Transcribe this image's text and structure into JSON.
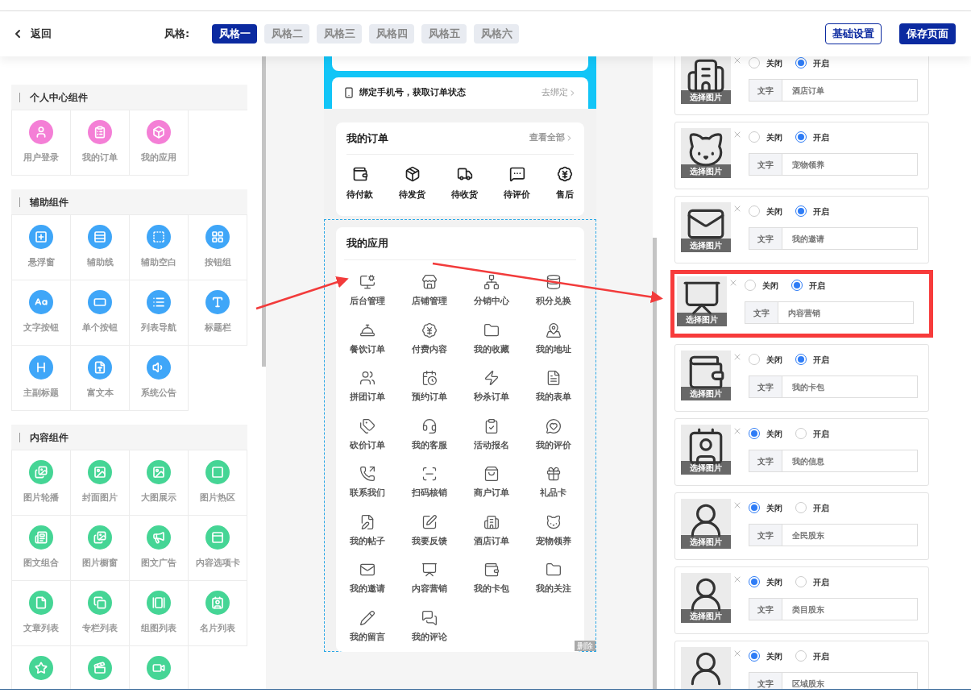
{
  "header": {
    "back": "返回",
    "style_label": "风格:",
    "styles": [
      {
        "label": "风格一",
        "selected": true
      },
      {
        "label": "风格二",
        "selected": false
      },
      {
        "label": "风格三",
        "selected": false
      },
      {
        "label": "风格四",
        "selected": false
      },
      {
        "label": "风格五",
        "selected": false
      },
      {
        "label": "风格六",
        "selected": false
      }
    ],
    "buttons": [
      {
        "label": "基础设置",
        "kind": "outline"
      },
      {
        "label": "保存页面",
        "kind": "primary"
      }
    ]
  },
  "component_groups": [
    {
      "title": "个人中心组件",
      "color": "#f47fd6",
      "items": [
        {
          "kind": "labeled",
          "label": "用户登录"
        },
        {
          "kind": "labeled",
          "label": "我的订单"
        },
        {
          "kind": "labeled",
          "label": "我的应用"
        }
      ]
    },
    {
      "title": "辅助组件",
      "color": "#3fa6f8",
      "items": [
        {
          "kind": "labeled",
          "label": "悬浮窗"
        },
        {
          "kind": "labeled",
          "label": "辅助线"
        },
        {
          "kind": "labeled",
          "label": "辅助空白"
        },
        {
          "kind": "labeled",
          "label": "按钮组"
        },
        {
          "kind": "labeled",
          "label": "文字按钮"
        },
        {
          "kind": "labeled",
          "label": "单个按钮"
        },
        {
          "kind": "labeled",
          "label": "列表导航"
        },
        {
          "kind": "labeled",
          "label": "标题栏"
        },
        {
          "kind": "labeled",
          "label": "主副标题"
        },
        {
          "kind": "labeled",
          "label": "富文本"
        },
        {
          "kind": "labeled",
          "label": "系统公告"
        }
      ]
    },
    {
      "title": "内容组件",
      "color": "#45d595",
      "items": [
        {
          "kind": "labeled",
          "label": "图片轮播"
        },
        {
          "kind": "labeled",
          "label": "封面图片"
        },
        {
          "kind": "labeled",
          "label": "大图展示"
        },
        {
          "kind": "labeled",
          "label": "图片热区"
        },
        {
          "kind": "labeled",
          "label": "图文组合"
        },
        {
          "kind": "labeled",
          "label": "图片橱窗"
        },
        {
          "kind": "labeled",
          "label": "图文广告"
        },
        {
          "kind": "labeled",
          "label": "内容选项卡"
        },
        {
          "kind": "labeled",
          "label": "文章列表"
        },
        {
          "kind": "labeled",
          "label": "专栏列表"
        },
        {
          "kind": "labeled",
          "label": "组图列表"
        },
        {
          "kind": "labeled",
          "label": "名片列表"
        },
        {
          "kind": "icon-only"
        },
        {
          "kind": "icon-only"
        },
        {
          "kind": "icon-only"
        }
      ]
    }
  ],
  "phone": {
    "bind_bar": {
      "text": "绑定手机号，获取订单状态",
      "action": "去绑定"
    },
    "orders": {
      "title": "我的订单",
      "more": "查看全部",
      "items": [
        "待付款",
        "待发货",
        "待收货",
        "待评价",
        "售后"
      ]
    },
    "apps": {
      "title": "我的应用",
      "selected": true,
      "delete": "删除",
      "items": [
        "后台管理",
        "店铺管理",
        "分销中心",
        "积分兑换",
        "餐饮订单",
        "付费内容",
        "我的收藏",
        "我的地址",
        "拼团订单",
        "预约订单",
        "秒杀订单",
        "我的表单",
        "砍价订单",
        "我的客服",
        "活动报名",
        "我的评价",
        "联系我们",
        "扫码核销",
        "商户订单",
        "礼品卡",
        "我的帖子",
        "我要反馈",
        "酒店订单",
        "宠物领养",
        "我的邀请",
        "内容营销",
        "我的卡包",
        "我的关注",
        "我的留言",
        "我的评论"
      ]
    }
  },
  "settings_rows": [
    {
      "image_label": "选择图片",
      "options": [
        {
          "label": "关闭",
          "selected": false
        },
        {
          "label": "开启",
          "selected": true
        }
      ],
      "field_label": "文字",
      "value": "酒店订单",
      "highlighted": false
    },
    {
      "image_label": "选择图片",
      "options": [
        {
          "label": "关闭",
          "selected": false
        },
        {
          "label": "开启",
          "selected": true
        }
      ],
      "field_label": "文字",
      "value": "宠物领养",
      "highlighted": false
    },
    {
      "image_label": "选择图片",
      "options": [
        {
          "label": "关闭",
          "selected": false
        },
        {
          "label": "开启",
          "selected": true
        }
      ],
      "field_label": "文字",
      "value": "我的邀请",
      "highlighted": false
    },
    {
      "image_label": "选择图片",
      "options": [
        {
          "label": "关闭",
          "selected": false
        },
        {
          "label": "开启",
          "selected": true
        }
      ],
      "field_label": "文字",
      "value": "内容营销",
      "highlighted": true
    },
    {
      "image_label": "选择图片",
      "options": [
        {
          "label": "关闭",
          "selected": false
        },
        {
          "label": "开启",
          "selected": true
        }
      ],
      "field_label": "文字",
      "value": "我的卡包",
      "highlighted": false
    },
    {
      "image_label": "选择图片",
      "options": [
        {
          "label": "关闭",
          "selected": true
        },
        {
          "label": "开启",
          "selected": false
        }
      ],
      "field_label": "文字",
      "value": "我的信息",
      "highlighted": false
    },
    {
      "image_label": "选择图片",
      "options": [
        {
          "label": "关闭",
          "selected": true
        },
        {
          "label": "开启",
          "selected": false
        }
      ],
      "field_label": "文字",
      "value": "全民股东",
      "highlighted": false
    },
    {
      "image_label": "选择图片",
      "options": [
        {
          "label": "关闭",
          "selected": true
        },
        {
          "label": "开启",
          "selected": false
        }
      ],
      "field_label": "文字",
      "value": "类目股东",
      "highlighted": false
    },
    {
      "options": [
        {
          "label": "关闭",
          "selected": true
        },
        {
          "label": "开启",
          "selected": false
        }
      ],
      "field_label": "文字",
      "value": "区域股东",
      "highlighted": false
    }
  ]
}
